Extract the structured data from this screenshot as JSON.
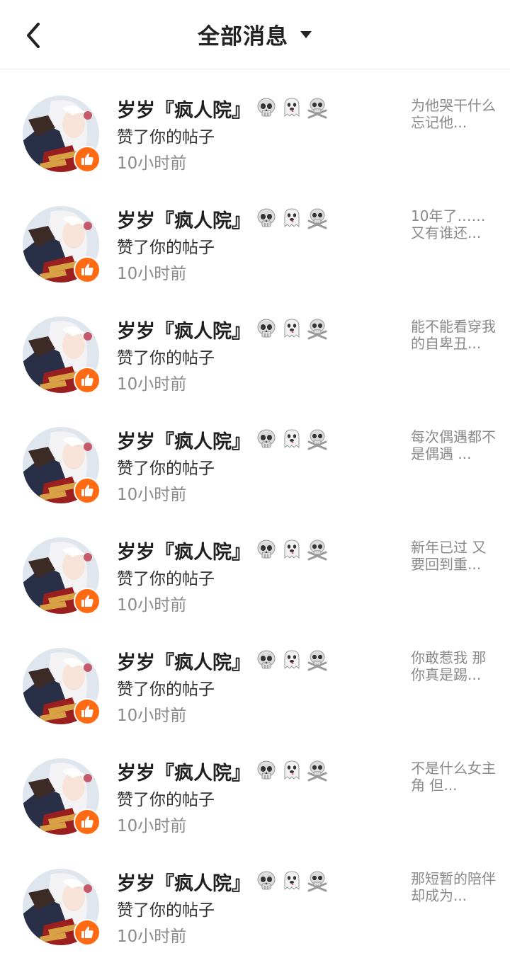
{
  "header": {
    "title": "全部消息",
    "back_icon": "chevron-left-icon",
    "dropdown_icon": "caret-down-icon"
  },
  "accent_color": "#ff6a13",
  "notifications": [
    {
      "user": "岁岁『疯人院』",
      "emojis": [
        "skull-icon",
        "ghost-icon",
        "skull-crossbones-icon"
      ],
      "action": "赞了你的帖子",
      "time": "10小时前",
      "excerpt": "为他哭干什么 忘记他..."
    },
    {
      "user": "岁岁『疯人院』",
      "emojis": [
        "skull-icon",
        "ghost-icon",
        "skull-crossbones-icon"
      ],
      "action": "赞了你的帖子",
      "time": "10小时前",
      "excerpt": "10年了……又有谁还..."
    },
    {
      "user": "岁岁『疯人院』",
      "emojis": [
        "skull-icon",
        "ghost-icon",
        "skull-crossbones-icon"
      ],
      "action": "赞了你的帖子",
      "time": "10小时前",
      "excerpt": "能不能看穿我的自卑丑..."
    },
    {
      "user": "岁岁『疯人院』",
      "emojis": [
        "skull-icon",
        "ghost-icon",
        "skull-crossbones-icon"
      ],
      "action": "赞了你的帖子",
      "time": "10小时前",
      "excerpt": "每次偶遇都不是偶遇 ..."
    },
    {
      "user": "岁岁『疯人院』",
      "emojis": [
        "skull-icon",
        "ghost-icon",
        "skull-crossbones-icon"
      ],
      "action": "赞了你的帖子",
      "time": "10小时前",
      "excerpt": "新年已过 又要回到重..."
    },
    {
      "user": "岁岁『疯人院』",
      "emojis": [
        "skull-icon",
        "ghost-icon",
        "skull-crossbones-icon"
      ],
      "action": "赞了你的帖子",
      "time": "10小时前",
      "excerpt": "你敢惹我 那你真是踢..."
    },
    {
      "user": "岁岁『疯人院』",
      "emojis": [
        "skull-icon",
        "ghost-icon",
        "skull-crossbones-icon"
      ],
      "action": "赞了你的帖子",
      "time": "10小时前",
      "excerpt": "不是什么女主角 但..."
    },
    {
      "user": "岁岁『疯人院』",
      "emojis": [
        "skull-icon",
        "ghost-icon",
        "skull-crossbones-icon"
      ],
      "action": "赞了你的帖子",
      "time": "10小时前",
      "excerpt": "那短暂的陪伴 却成为..."
    }
  ]
}
